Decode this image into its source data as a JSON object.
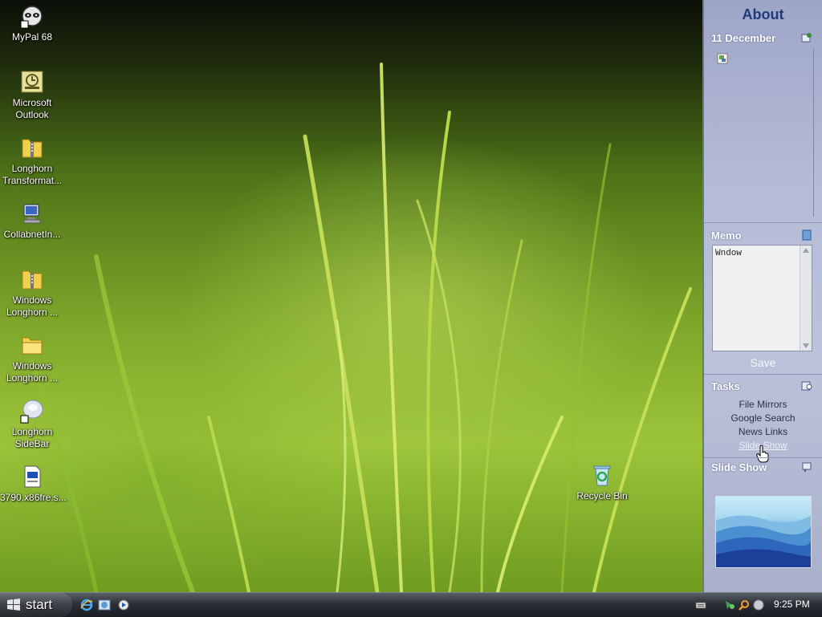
{
  "desktop": {
    "icons": [
      {
        "label": "MyPal 68",
        "icon": "raccoon-shortcut-icon"
      },
      {
        "label": "Microsoft Outlook",
        "icon": "outlook-icon"
      },
      {
        "label": "Longhorn Transformat...",
        "icon": "zip-folder-icon"
      },
      {
        "label": "CollabnetIn...",
        "icon": "computer-setup-icon"
      },
      {
        "label": "Windows Longhorn ...",
        "icon": "zip-folder-icon"
      },
      {
        "label": "Windows Longhorn ...",
        "icon": "folder-icon"
      },
      {
        "label": "Longhorn SideBar",
        "icon": "sidebar-shortcut-icon"
      },
      {
        "label": "3790.x86fre.s...",
        "icon": "document-icon"
      }
    ],
    "recycle_bin": {
      "label": "Recycle Bin",
      "icon": "recycle-bin-icon"
    }
  },
  "sidebar": {
    "title": "About",
    "calendar": {
      "heading": "11 December"
    },
    "memo": {
      "heading": "Memo",
      "text": "Wndow",
      "save_label": "Save"
    },
    "tasks": {
      "heading": "Tasks",
      "items": [
        "File Mirrors",
        "Google Search",
        "News Links",
        "Slide Show"
      ]
    },
    "slideshow": {
      "heading": "Slide Show"
    }
  },
  "taskbar": {
    "start_label": "start",
    "clock": "9:25 PM",
    "quick_launch": [
      "internet-explorer-icon",
      "explorer-icon",
      "media-player-icon"
    ],
    "tray": [
      "keyboard-icon",
      "network-icon",
      "search-icon",
      "messenger-icon"
    ]
  },
  "colors": {
    "sidebar_title": "#1f3b78",
    "sidebar_bg": "#b4bbd6",
    "taskbar_bg": "#2c3036"
  }
}
